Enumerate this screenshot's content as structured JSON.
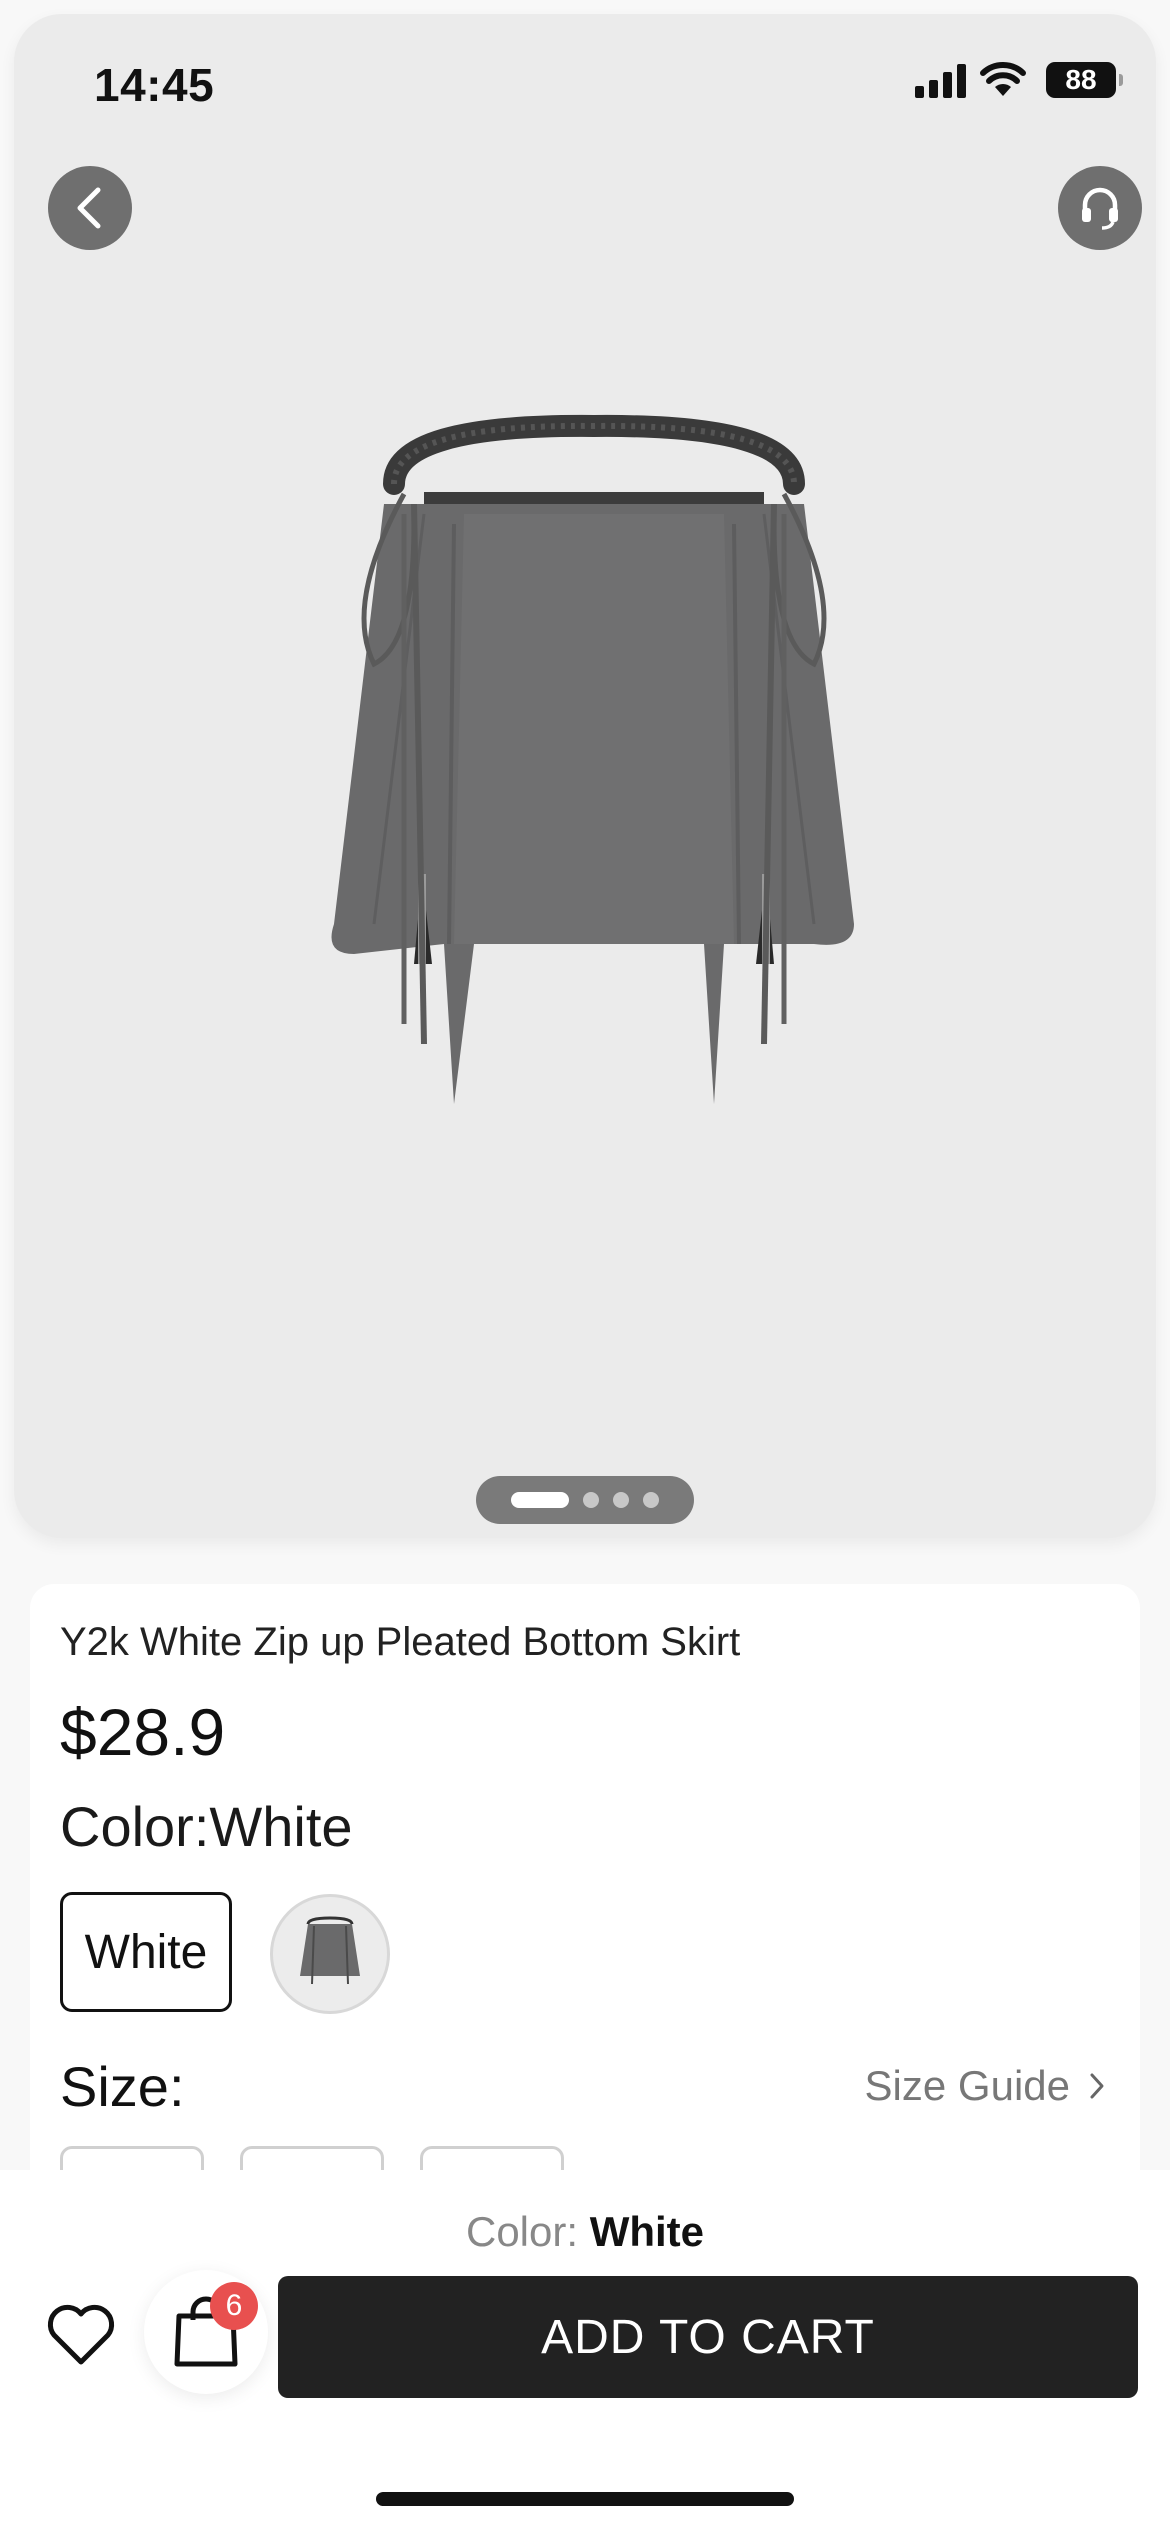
{
  "status": {
    "time": "14:45",
    "battery": "88"
  },
  "gallery": {
    "total_pages": 4,
    "active_page": 1
  },
  "product": {
    "title": "Y2k White Zip up Pleated Bottom Skirt",
    "price": "$28.9",
    "color_heading": "Color:White",
    "swatch_label": "White"
  },
  "size": {
    "label": "Size:",
    "guide_label": "Size Guide"
  },
  "bottom_bar": {
    "color_prefix": "Color:",
    "color_value": "White",
    "cart_badge": "6",
    "add_to_cart": "ADD TO CART"
  },
  "colors": {
    "accent": "#222222",
    "badge": "#e8504f",
    "gallery_bg": "#ebebeb"
  },
  "icons": [
    "chevron-left-icon",
    "headset-icon",
    "heart-icon",
    "shopping-bag-icon",
    "chevron-right-icon",
    "signal-icon",
    "wifi-icon",
    "battery-icon"
  ]
}
